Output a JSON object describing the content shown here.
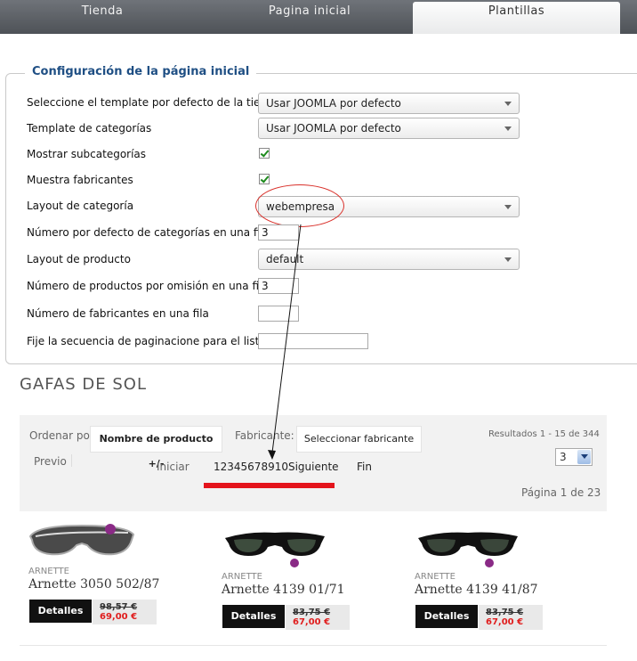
{
  "tabs": [
    "Tienda",
    "Pagina inicial",
    "Plantillas"
  ],
  "config": {
    "legend": "Configuración de la página inicial",
    "rows": {
      "default_template_label": "Seleccione el template por defecto de la tienda",
      "default_template_value": "Usar JOOMLA por defecto",
      "category_template_label": "Template de categorías",
      "category_template_value": "Usar JOOMLA por defecto",
      "show_subcategories_label": "Mostrar subcategorías",
      "show_subcategories_checked": true,
      "show_manufacturers_label": "Muestra fabricantes",
      "show_manufacturers_checked": true,
      "category_layout_label": "Layout de categoría",
      "category_layout_value": "webempresa",
      "categories_per_row_label": "Número por defecto de categorías en una fila",
      "categories_per_row_value": "3",
      "product_layout_label": "Layout de producto",
      "product_layout_value": "default",
      "products_per_row_label": "Número de productos por omisión en una fila",
      "products_per_row_value": "3",
      "manufacturers_per_row_label": "Número de fabricantes en una fila",
      "manufacturers_per_row_value": "",
      "pagination_sequence_label": "Fije la secuencia de paginacione para el listado",
      "pagination_sequence_value": ""
    }
  },
  "category": {
    "title": "GAFAS DE SOL",
    "order_label": "Ordenar por",
    "order_value": "Nombre de producto +/-",
    "manufacturer_label": "Fabricante:",
    "manufacturer_value": "Seleccionar fabricante",
    "results_text": "Resultados 1 - 15 de 344",
    "prev": "Previo",
    "start": "Iniciar",
    "pages_next": "12345678910Siguiente",
    "end": "Fin",
    "per_page_value": "3",
    "page_info": "Página 1 de 23"
  },
  "products": [
    {
      "brand": "ARNETTE",
      "name": "Arnette 3050 502/87",
      "details_label": "Detalles",
      "old_price": "98,57 €",
      "price": "69,00 €"
    },
    {
      "brand": "ARNETTE",
      "name": "Arnette 4139 01/71",
      "details_label": "Detalles",
      "old_price": "83,75 €",
      "price": "67,00 €"
    },
    {
      "brand": "ARNETTE",
      "name": "Arnette 4139 41/87",
      "details_label": "Detalles",
      "old_price": "83,75 €",
      "price": "67,00 €"
    }
  ],
  "colors": {
    "legend_blue": "#1f4f84",
    "check_green": "#1c8a1c",
    "annotation_red": "#e4141c",
    "price_red": "#e01d1d"
  },
  "icons": [
    "dropdown-arrow-icon",
    "checkbox-checked-icon",
    "sunglasses-image",
    "brand-badge-icon"
  ]
}
